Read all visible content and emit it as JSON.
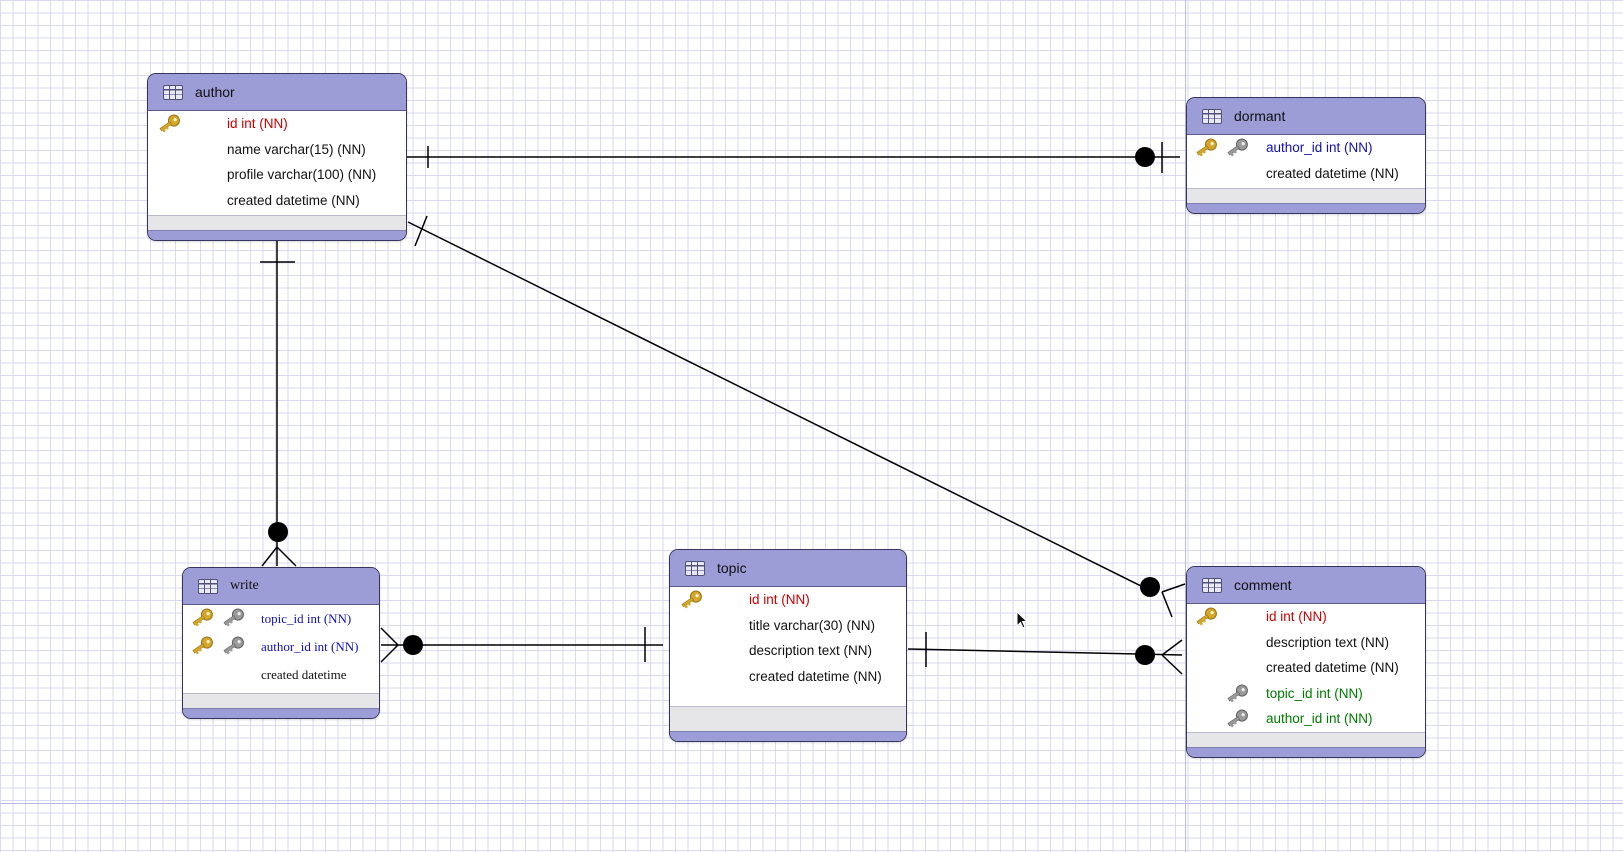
{
  "diagram": {
    "entities": [
      {
        "id": "author",
        "name": "author",
        "columns": [
          {
            "text": "id int (NN)",
            "kind": "pk",
            "keys": [
              "primary-key"
            ]
          },
          {
            "text": "name varchar(15) (NN)",
            "kind": "plain",
            "keys": []
          },
          {
            "text": "profile varchar(100) (NN)",
            "kind": "plain",
            "keys": []
          },
          {
            "text": "created datetime (NN)",
            "kind": "plain",
            "keys": []
          }
        ]
      },
      {
        "id": "dormant",
        "name": "dormant",
        "columns": [
          {
            "text": "author_id int (NN)",
            "kind": "fk",
            "keys": [
              "primary-key",
              "foreign-key"
            ]
          },
          {
            "text": "created datetime (NN)",
            "kind": "plain",
            "keys": []
          }
        ]
      },
      {
        "id": "write",
        "name": "write",
        "columns": [
          {
            "text": "topic_id int (NN)",
            "kind": "fk",
            "keys": [
              "primary-key",
              "foreign-key"
            ]
          },
          {
            "text": "author_id int (NN)",
            "kind": "fk",
            "keys": [
              "primary-key",
              "foreign-key"
            ]
          },
          {
            "text": "created datetime",
            "kind": "plain",
            "keys": []
          }
        ]
      },
      {
        "id": "topic",
        "name": "topic",
        "columns": [
          {
            "text": "id int (NN)",
            "kind": "pk",
            "keys": [
              "primary-key"
            ]
          },
          {
            "text": "title varchar(30) (NN)",
            "kind": "plain",
            "keys": []
          },
          {
            "text": "description text (NN)",
            "kind": "plain",
            "keys": []
          },
          {
            "text": "created datetime (NN)",
            "kind": "plain",
            "keys": []
          }
        ]
      },
      {
        "id": "comment",
        "name": "comment",
        "columns": [
          {
            "text": "id int (NN)",
            "kind": "pk",
            "keys": [
              "primary-key"
            ]
          },
          {
            "text": "description text (NN)",
            "kind": "plain",
            "keys": []
          },
          {
            "text": "created datetime (NN)",
            "kind": "plain",
            "keys": []
          },
          {
            "text": "topic_id int (NN)",
            "kind": "fk2",
            "keys": [
              "foreign-key"
            ]
          },
          {
            "text": "author_id int (NN)",
            "kind": "fk2",
            "keys": [
              "foreign-key"
            ]
          }
        ]
      }
    ],
    "relationships": [
      {
        "from": "author",
        "to": "dormant",
        "from_cardinality": "one",
        "to_cardinality": "zero-or-one"
      },
      {
        "from": "author",
        "to": "comment",
        "from_cardinality": "one",
        "to_cardinality": "zero-or-many"
      },
      {
        "from": "author",
        "to": "write",
        "from_cardinality": "one",
        "to_cardinality": "zero-or-many"
      },
      {
        "from": "topic",
        "to": "write",
        "from_cardinality": "one",
        "to_cardinality": "zero-or-many"
      },
      {
        "from": "topic",
        "to": "comment",
        "from_cardinality": "one",
        "to_cardinality": "zero-or-many"
      }
    ],
    "colors": {
      "header": "#9c9cd6",
      "border": "#34345e",
      "primary_key_text": "#cc0000",
      "foreign_key_text": "#1010b0",
      "non_key_fk_text": "#007a00",
      "grid": "#d9d9f2"
    },
    "icons": {
      "table": "table-icon",
      "primary_key": "gold-key-icon",
      "foreign_key": "grey-key-icon",
      "cursor": "mouse-pointer-icon"
    }
  }
}
